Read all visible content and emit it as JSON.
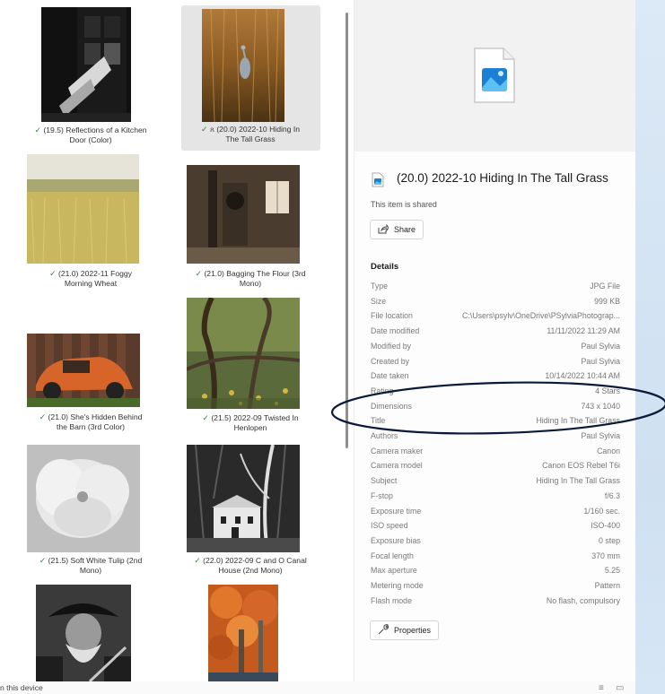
{
  "grid": {
    "items": [
      {
        "caption_l1": "(19.5) Reflections of a Kitchen",
        "caption_l2": "Door (Color)",
        "shared": false
      },
      {
        "caption_l1": "(20.0) 2022-10 Hiding In",
        "caption_l2": "The Tall Grass",
        "shared": true
      },
      {
        "caption_l1": "(21.0) 2022-11 Foggy",
        "caption_l2": "Morning Wheat",
        "shared": false
      },
      {
        "caption_l1": "(21.0) Bagging The Flour (3rd",
        "caption_l2": "Mono)",
        "shared": false
      },
      {
        "caption_l1": "(21.0) She's Hidden Behind",
        "caption_l2": "the Barn (3rd Color)",
        "shared": false
      },
      {
        "caption_l1": "(21.5) 2022-09 Twisted In",
        "caption_l2": "Henlopen",
        "shared": false
      },
      {
        "caption_l1": "(21.5) Soft White Tulip (2nd",
        "caption_l2": "Mono)",
        "shared": false
      },
      {
        "caption_l1": "(22.0) 2022-09 C and O Canal",
        "caption_l2": "House (2nd Mono)",
        "shared": false
      }
    ],
    "selected_index": 1,
    "check_glyph": "✓",
    "person_glyph": "ጸ"
  },
  "status": {
    "text": "n this device"
  },
  "details": {
    "title": "(20.0) 2022-10 Hiding In The Tall Grass",
    "shared_text": "This item is shared",
    "share_label": "Share",
    "details_heading": "Details",
    "properties_label": "Properties",
    "rows": [
      {
        "key": "Type",
        "value": "JPG File"
      },
      {
        "key": "Size",
        "value": "999 KB"
      },
      {
        "key": "File location",
        "value": "C:\\Users\\psylv\\OneDrive\\PSylviaPhotograp..."
      },
      {
        "key": "Date modified",
        "value": "11/11/2022 11:29 AM"
      },
      {
        "key": "Modified by",
        "value": "Paul Sylvia"
      },
      {
        "key": "Created by",
        "value": "Paul Sylvia"
      },
      {
        "key": "Date taken",
        "value": "10/14/2022 10:44 AM"
      },
      {
        "key": "Rating",
        "value": "4 Stars"
      },
      {
        "key": "Dimensions",
        "value": "743 x 1040"
      },
      {
        "key": "Title",
        "value": "Hiding In The Tall Grass"
      },
      {
        "key": "Authors",
        "value": "Paul Sylvia"
      },
      {
        "key": "Camera maker",
        "value": "Canon"
      },
      {
        "key": "Camera model",
        "value": "Canon EOS Rebel T6i"
      },
      {
        "key": "Subject",
        "value": "Hiding In The Tall Grass"
      },
      {
        "key": "F-stop",
        "value": "f/6.3"
      },
      {
        "key": "Exposure time",
        "value": "1/160 sec."
      },
      {
        "key": "ISO speed",
        "value": "ISO-400"
      },
      {
        "key": "Exposure bias",
        "value": "0 step"
      },
      {
        "key": "Focal length",
        "value": "370 mm"
      },
      {
        "key": "Max aperture",
        "value": "5.25"
      },
      {
        "key": "Metering mode",
        "value": "Pattern"
      },
      {
        "key": "Flash mode",
        "value": "No flash, compulsory"
      }
    ]
  },
  "icons": {
    "share": "share-icon",
    "properties": "wrench-icon",
    "details_view": "details-view-icon",
    "large_icons_view": "large-icons-view-icon"
  },
  "colors": {
    "check": "#2f8a3f",
    "annotation": "#0a1a3a",
    "selection": "#e5e5e5"
  }
}
